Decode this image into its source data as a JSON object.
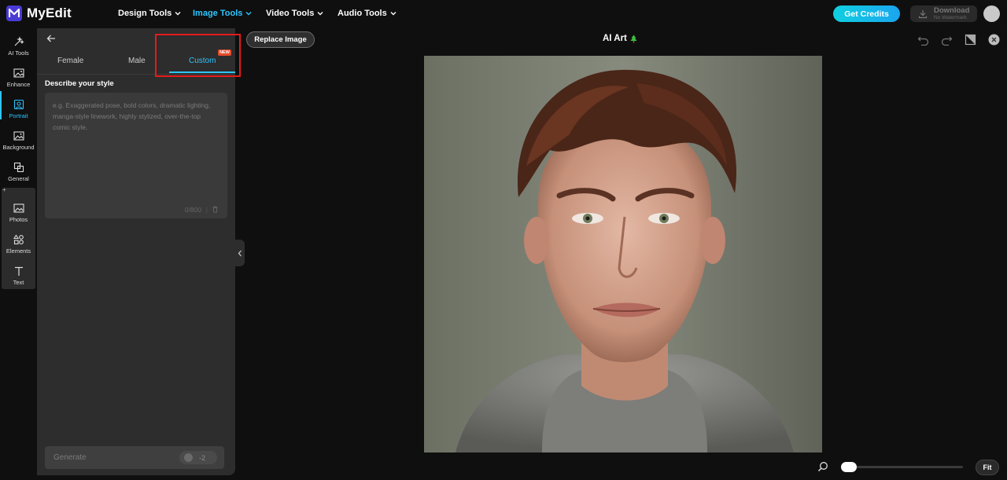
{
  "app": {
    "name": "MyEdit"
  },
  "nav": {
    "design_tools": "Design Tools",
    "image_tools": "Image Tools",
    "video_tools": "Video Tools",
    "audio_tools": "Audio Tools"
  },
  "header": {
    "get_credits": "Get Credits",
    "download_label": "Download",
    "download_sub": "No Watermark"
  },
  "rail": {
    "items": [
      "AI Tools",
      "Enhance",
      "Portrait",
      "Background",
      "General",
      "Photos",
      "Elements",
      "Text"
    ],
    "active": "Portrait"
  },
  "panel": {
    "tabs": [
      "Female",
      "Male",
      "Custom"
    ],
    "active_tab": "Custom",
    "new_badge": "NEW",
    "section_label": "Describe your style",
    "placeholder": "e.g. Exaggerated pose, bold colors, dramatic lighting, manga-style linework, highly stylized, over-the-top comic style.",
    "char_count": "0/800",
    "generate_label": "Generate",
    "generate_cost": "-2"
  },
  "canvas": {
    "replace_image": "Replace Image",
    "title": "AI Art",
    "fit_label": "Fit"
  },
  "colors": {
    "accent": "#2cc5ff",
    "credits_start": "#10d0e0",
    "credits_end": "#1aa5f0",
    "highlight": "#e51b1b"
  }
}
